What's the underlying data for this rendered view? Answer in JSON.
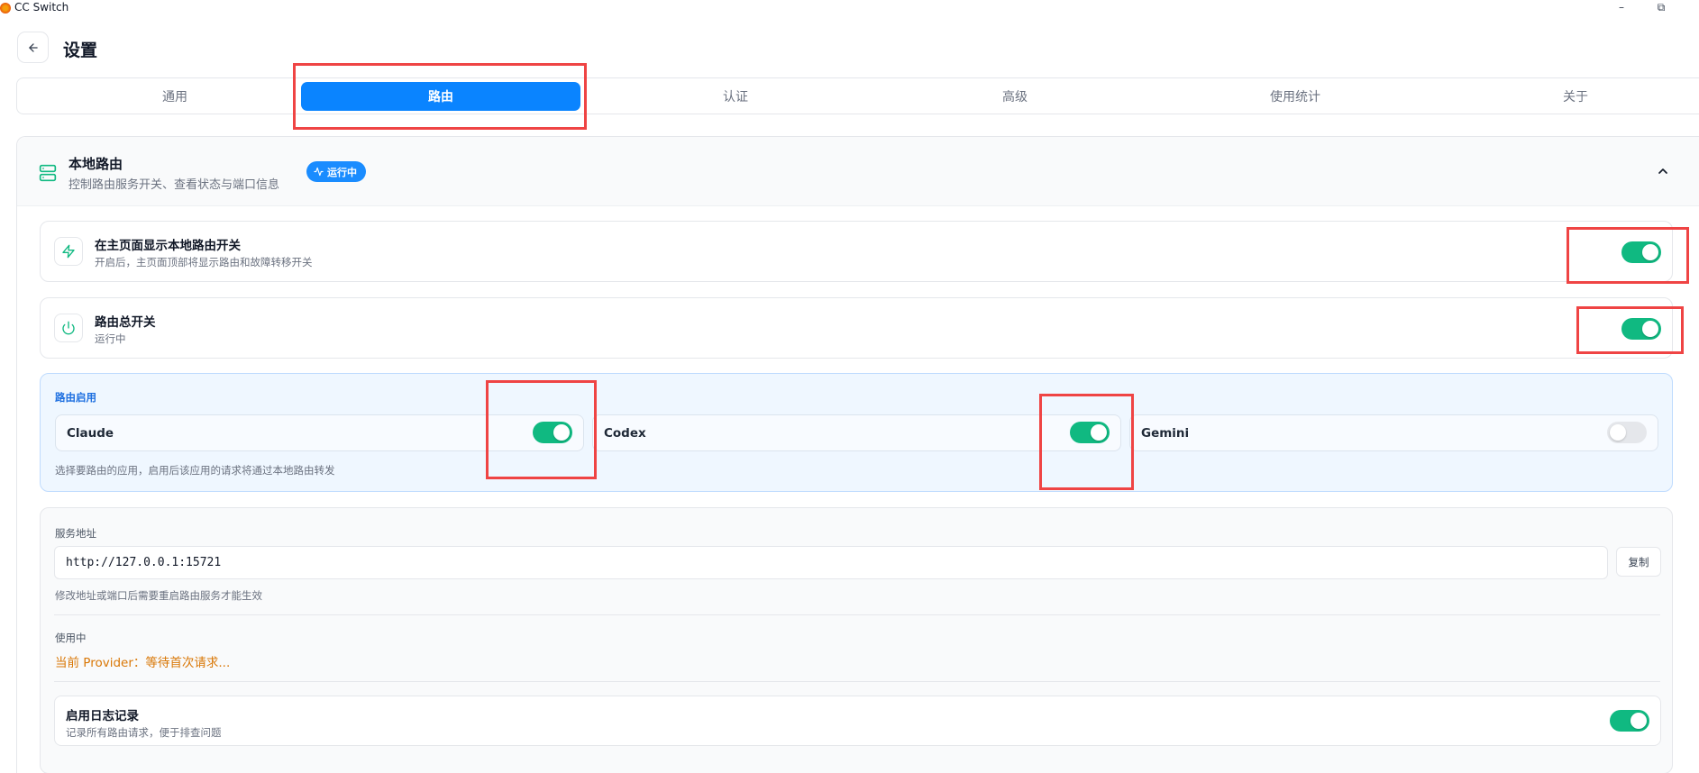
{
  "window": {
    "title": "CC Switch",
    "minimize_glyph": "–",
    "restore_glyph": "⧉",
    "logo_icon": "cc-switch-logo"
  },
  "header": {
    "back_icon": "arrow-left-icon",
    "title": "设置"
  },
  "tabs": [
    {
      "label": "通用",
      "active": false
    },
    {
      "label": "路由",
      "active": true
    },
    {
      "label": "认证",
      "active": false
    },
    {
      "label": "高级",
      "active": false
    },
    {
      "label": "使用统计",
      "active": false
    },
    {
      "label": "关于",
      "active": false
    }
  ],
  "section": {
    "icon": "server-icon",
    "title": "本地路由",
    "subtitle": "控制路由服务开关、查看状态与端口信息",
    "status_badge": "运行中",
    "status_icon": "activity-icon",
    "collapse_icon": "chevron-up-icon"
  },
  "rows": {
    "show_on_home": {
      "icon": "zap-icon",
      "title": "在主页面显示本地路由开关",
      "description": "开启后，主页面顶部将显示路由和故障转移开关",
      "enabled": true
    },
    "master_switch": {
      "icon": "power-icon",
      "title": "路由总开关",
      "description": "运行中",
      "enabled": true
    }
  },
  "apps": {
    "label": "路由启用",
    "items": [
      {
        "name": "Claude",
        "enabled": true
      },
      {
        "name": "Codex",
        "enabled": true
      },
      {
        "name": "Gemini",
        "enabled": false
      }
    ],
    "hint": "选择要路由的应用，启用后该应用的请求将通过本地路由转发"
  },
  "service": {
    "address_label": "服务地址",
    "address_value": "http://127.0.0.1:15721",
    "copy_label": "复制",
    "address_hint": "修改地址或端口后需要重启路由服务才能生效",
    "in_use_label": "使用中",
    "current_provider": "当前 Provider：等待首次请求...",
    "logging": {
      "title": "启用日志记录",
      "description": "记录所有路由请求，便于排查问题",
      "enabled": true
    }
  },
  "colors": {
    "accent": "#0a84ff",
    "toggle_on": "#10b981",
    "toggle_off": "#e5e7eb",
    "provider_text": "#d97706",
    "annotation": "#ef4444"
  }
}
